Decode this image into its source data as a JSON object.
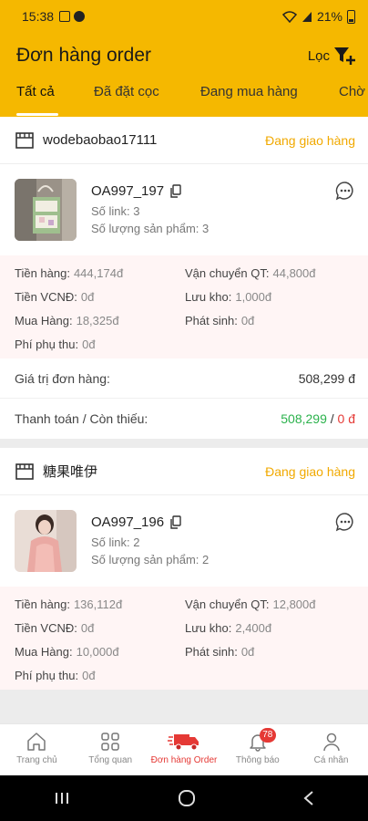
{
  "status_bar": {
    "time": "15:38",
    "battery": "21%"
  },
  "header": {
    "title": "Đơn hàng order",
    "filter_label": "Lọc"
  },
  "tabs": [
    {
      "label": "Tất cả",
      "active": true
    },
    {
      "label": "Đã đặt cọc"
    },
    {
      "label": "Đang mua hàng"
    },
    {
      "label": "Chờ"
    }
  ],
  "orders": [
    {
      "shop": "wodebaobao17111",
      "status": "Đang giao hàng",
      "code": "OA997_197",
      "links": "Số link: 3",
      "qty": "Số lượng sản phẩm: 3",
      "fees": {
        "tien_hang": {
          "label": "Tiền hàng:",
          "value": "444,174đ"
        },
        "van_chuyen": {
          "label": "Vận chuyển QT:",
          "value": "44,800đ"
        },
        "tien_vcnd": {
          "label": "Tiền VCNĐ:",
          "value": "0đ"
        },
        "luu_kho": {
          "label": "Lưu kho:",
          "value": "1,000đ"
        },
        "mua_hang": {
          "label": "Mua Hàng:",
          "value": "18,325đ"
        },
        "phat_sinh": {
          "label": "Phát sinh:",
          "value": "0đ"
        },
        "phi_phu_thu": {
          "label": "Phí phụ thu:",
          "value": "0đ"
        }
      },
      "total_label": "Giá trị đơn hàng:",
      "total_value": "508,299 đ",
      "payment_label": "Thanh toán / Còn thiếu:",
      "paid": "508,299",
      "separator": " / ",
      "owed": "0 đ"
    },
    {
      "shop": "糖果唯伊",
      "status": "Đang giao hàng",
      "code": "OA997_196",
      "links": "Số link: 2",
      "qty": "Số lượng sản phẩm: 2",
      "fees": {
        "tien_hang": {
          "label": "Tiền hàng:",
          "value": "136,112đ"
        },
        "van_chuyen": {
          "label": "Vận chuyển QT:",
          "value": "12,800đ"
        },
        "tien_vcnd": {
          "label": "Tiền VCNĐ:",
          "value": "0đ"
        },
        "luu_kho": {
          "label": "Lưu kho:",
          "value": "2,400đ"
        },
        "mua_hang": {
          "label": "Mua Hàng:",
          "value": "10,000đ"
        },
        "phat_sinh": {
          "label": "Phát sinh:",
          "value": "0đ"
        },
        "phi_phu_thu": {
          "label": "Phí phụ thu:",
          "value": "0đ"
        }
      }
    }
  ],
  "bottom_nav": [
    {
      "label": "Trang chủ",
      "icon": "home-icon"
    },
    {
      "label": "Tổng quan",
      "icon": "grid-icon"
    },
    {
      "label": "Đơn hàng Order",
      "icon": "truck-icon",
      "active": true
    },
    {
      "label": "Thông báo",
      "icon": "bell-icon",
      "badge": "78"
    },
    {
      "label": "Cá nhân",
      "icon": "user-icon"
    }
  ],
  "colors": {
    "header": "#f5b800",
    "status": "#f1a900",
    "paid": "#2bb24c",
    "owed": "#e53935",
    "accent": "#e53935"
  }
}
